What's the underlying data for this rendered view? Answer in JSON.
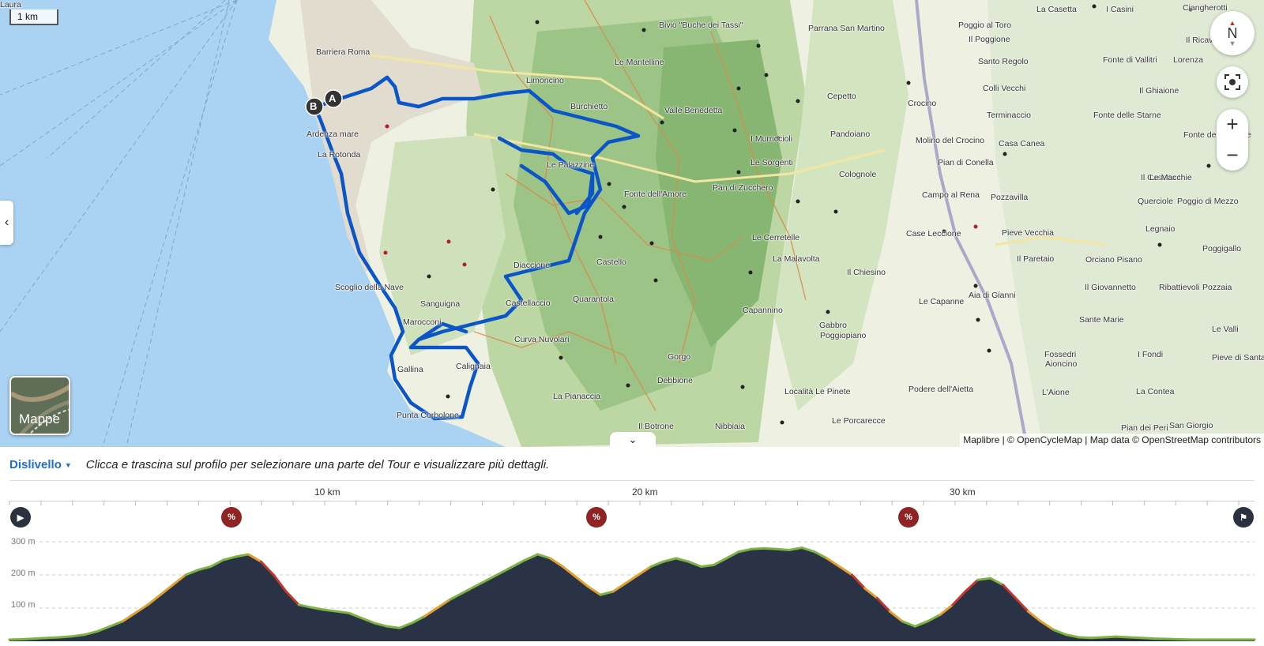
{
  "map": {
    "scale_label": "1 km",
    "compass_label": "N",
    "layers_label": "Mappe",
    "attribution": "Maplibre | © OpenCycleMap | Map data © OpenStreetMap contributors",
    "route_color": "#0a55c8",
    "start_marker": "A",
    "end_marker": "B",
    "places": [
      "Barriera Roma",
      "Ardenza mare",
      "La Rotonda",
      "Scoglio della Nave",
      "Sanguigna",
      "Marocconi",
      "Gallina",
      "Calignaia",
      "Punta Corbolone",
      "Diaccione",
      "Castellaccio",
      "Quarantola",
      "Curva Nuvolari",
      "La Pianaccia",
      "Castello",
      "Le Palazzine",
      "Fonte dell'Amore",
      "Limoncino",
      "Burchietto",
      "Le Mantelline",
      "Bivio \"Buche dei Tassi\"",
      "Valle Benedetta",
      "I Murriccioli",
      "Le Sorgenti",
      "Pan di Zucchero",
      "Le Cerretelle",
      "La Malavolta",
      "Capannino",
      "Gorgo",
      "Debbione",
      "Il Botrone",
      "Nibbiaia",
      "Parrana San Martino",
      "Cepetto",
      "Pandoiano",
      "Colognole",
      "Il Chiesino",
      "Gabbro",
      "Poggiopiano",
      "Località Le Pinete",
      "Le Porcarecce",
      "Crocino",
      "Molino del Crocino",
      "Campo al Rena",
      "Case Leccione",
      "Le Capanne",
      "Podere dell'Aietta",
      "Aia di Gianni",
      "Poggio al Toro",
      "Il Poggione",
      "Santo Regolo",
      "Colli Vecchi",
      "Terminaccio",
      "Fonte delle Starne",
      "Casa Canea",
      "Pian di Conella",
      "Pozzavilla",
      "Pieve Vecchia",
      "Il Paretaio",
      "Orciano Pisano",
      "Il Giovannetto",
      "Sante Marie",
      "Aioncino",
      "L'Aione",
      "Fossedri",
      "I Fondi",
      "La Contea",
      "Pian dei Peri",
      "San Giorgio",
      "La Casetta",
      "I Casini",
      "Fonte di Vallitri",
      "Il Ghiaione",
      "Fonte delle Starne",
      "Il Casetta I",
      "Le Macchie",
      "Poggio di Mezzo",
      "Querciole",
      "Legnaio",
      "Poggigallo",
      "Pozzaia",
      "Ribattievoli",
      "Le Valli",
      "Pieve di Santa Luce",
      "Il Ricavo",
      "Lorenza",
      "Ciangherotti",
      "Laura"
    ]
  },
  "profile": {
    "dropdown_label": "Dislivello",
    "hint": "Clicca e trascina sul profilo per selezionare una parte del Tour e visualizzare più dettagli.",
    "km_labels": [
      "10 km",
      "20 km",
      "30 km"
    ],
    "y_labels": [
      "300 m",
      "200 m",
      "100 m"
    ],
    "markers": [
      "play-icon",
      "percent-icon",
      "percent-icon",
      "percent-icon",
      "finish-icon"
    ],
    "fill_color": "#2a3345",
    "line_color": "#7cb342",
    "steep_color": "#c0392b",
    "total_km": 39.5,
    "elevation_m": [
      5,
      6,
      8,
      10,
      12,
      15,
      20,
      30,
      45,
      60,
      85,
      110,
      140,
      170,
      200,
      215,
      225,
      245,
      255,
      262,
      240,
      200,
      150,
      110,
      102,
      95,
      90,
      85,
      70,
      55,
      45,
      40,
      55,
      75,
      100,
      125,
      145,
      165,
      185,
      205,
      225,
      245,
      262,
      250,
      225,
      195,
      165,
      140,
      150,
      175,
      200,
      225,
      240,
      250,
      240,
      225,
      230,
      250,
      270,
      278,
      280,
      278,
      275,
      282,
      270,
      250,
      225,
      200,
      160,
      130,
      90,
      60,
      45,
      60,
      80,
      110,
      150,
      185,
      190,
      170,
      130,
      90,
      60,
      35,
      20,
      12,
      10,
      12,
      14,
      12,
      10,
      8,
      7,
      6,
      5,
      5,
      5,
      5,
      5,
      5
    ]
  }
}
